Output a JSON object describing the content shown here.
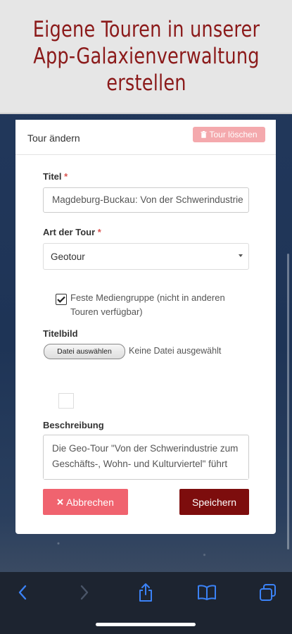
{
  "banner": {
    "title": "Eigene Touren in unserer App-Galaxienverwaltung erstellen"
  },
  "panel": {
    "title": "Tour ändern",
    "delete_button": "Tour löschen"
  },
  "form": {
    "title_label": "Titel",
    "title_value": "Magdeburg-Buckau: Von der Schwerindustrie",
    "required_mark": "*",
    "type_label": "Art der Tour",
    "type_value": "Geotour",
    "fixed_media_label": "Feste Mediengruppe (nicht in anderen Touren verfügbar)",
    "fixed_media_checked": true,
    "image_label": "Titelbild",
    "file_button": "Datei auswählen",
    "file_status": "Keine Datei ausgewählt",
    "description_label": "Beschreibung",
    "description_value": "Die Geo-Tour  \"Von der Schwerindustrie zum Geschäfts-, Wohn- und Kulturviertel\" führt",
    "cancel_button": "Abbrechen",
    "save_button": "Speichern"
  },
  "colors": {
    "banner_text": "#8b1a1a",
    "save_button": "#7d0d0d",
    "cancel_button": "#f0636f",
    "delete_button": "#f4a9ad",
    "toolbar_icons": "#3b82f6"
  },
  "toolbar": {
    "icons": [
      "back-icon",
      "forward-icon",
      "share-icon",
      "bookmarks-icon",
      "tabs-icon"
    ]
  }
}
